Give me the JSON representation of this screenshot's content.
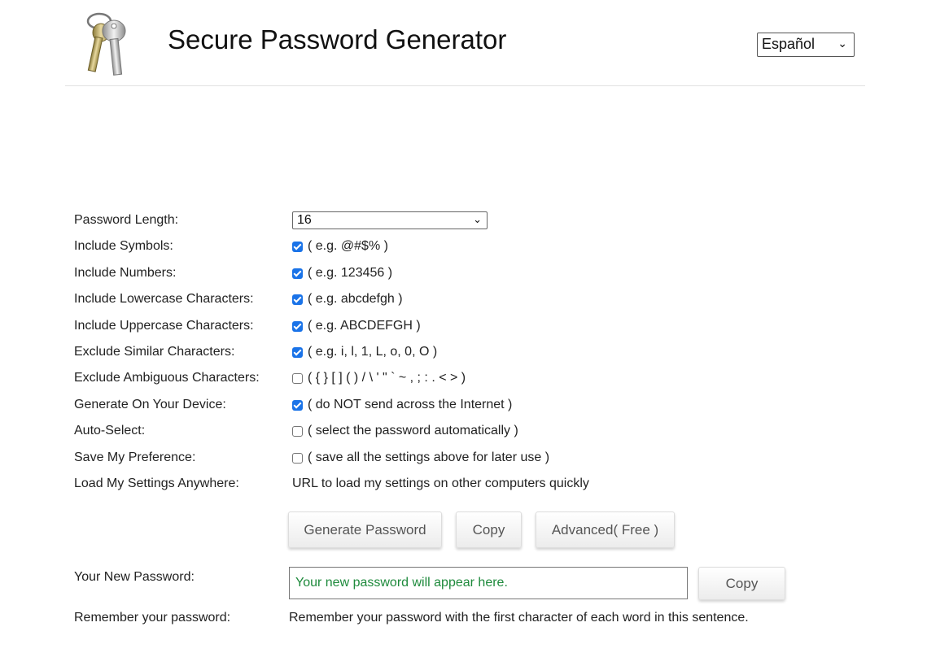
{
  "header": {
    "title": "Secure Password Generator",
    "logo_icon": "keys-icon",
    "language": "Español"
  },
  "form": {
    "length_label": "Password Length:",
    "length_value": "16",
    "rows": [
      {
        "label": "Include Symbols:",
        "checked": true,
        "hint": "( e.g. @#$% )"
      },
      {
        "label": "Include Numbers:",
        "checked": true,
        "hint": "( e.g. 123456 )"
      },
      {
        "label": "Include Lowercase Characters:",
        "checked": true,
        "hint": "( e.g. abcdefgh )"
      },
      {
        "label": "Include Uppercase Characters:",
        "checked": true,
        "hint": "( e.g. ABCDEFGH )"
      },
      {
        "label": "Exclude Similar Characters:",
        "checked": true,
        "hint": "( e.g. i, l, 1, L, o, 0, O )"
      },
      {
        "label": "Exclude Ambiguous Characters:",
        "checked": false,
        "hint": "( { } [ ] ( ) / \\ ' \" ` ~ , ; : . < > )"
      },
      {
        "label": "Generate On Your Device:",
        "checked": true,
        "hint": "( do NOT send across the Internet )"
      },
      {
        "label": "Auto-Select:",
        "checked": false,
        "hint": "( select the password automatically )"
      },
      {
        "label": "Save My Preference:",
        "checked": false,
        "hint": "( save all the settings above for later use )"
      }
    ],
    "load_label": "Load My Settings Anywhere:",
    "load_link": "URL to load my settings on other computers quickly"
  },
  "buttons": {
    "generate": "Generate Password",
    "copy": "Copy",
    "advanced": "Advanced( Free )"
  },
  "output": {
    "label": "Your New Password:",
    "placeholder": "Your new password will appear here.",
    "copy": "Copy",
    "remember_label": "Remember your password:",
    "remember_text": "Remember your password with the first character of each word in this sentence."
  },
  "colors": {
    "checkbox_accent": "#1a73e8",
    "placeholder_text": "#1e8a3c"
  }
}
